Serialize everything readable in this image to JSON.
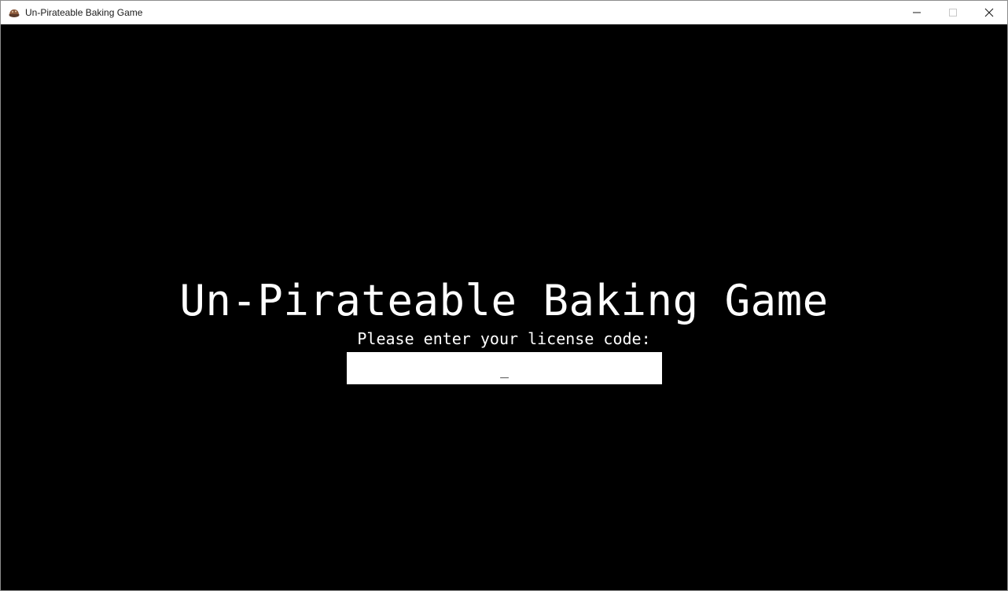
{
  "window": {
    "title": "Un-Pirateable Baking Game",
    "app_icon": "baking-game-icon",
    "controls": {
      "minimize_icon": "minimize-icon",
      "maximize_icon": "maximize-icon",
      "close_icon": "close-icon"
    }
  },
  "game": {
    "title": "Un-Pirateable Baking Game",
    "prompt": "Please enter your license code:",
    "license_input": {
      "value": "_"
    }
  },
  "colors": {
    "background": "#000000",
    "text": "#ffffff",
    "input_bg": "#ffffff"
  }
}
